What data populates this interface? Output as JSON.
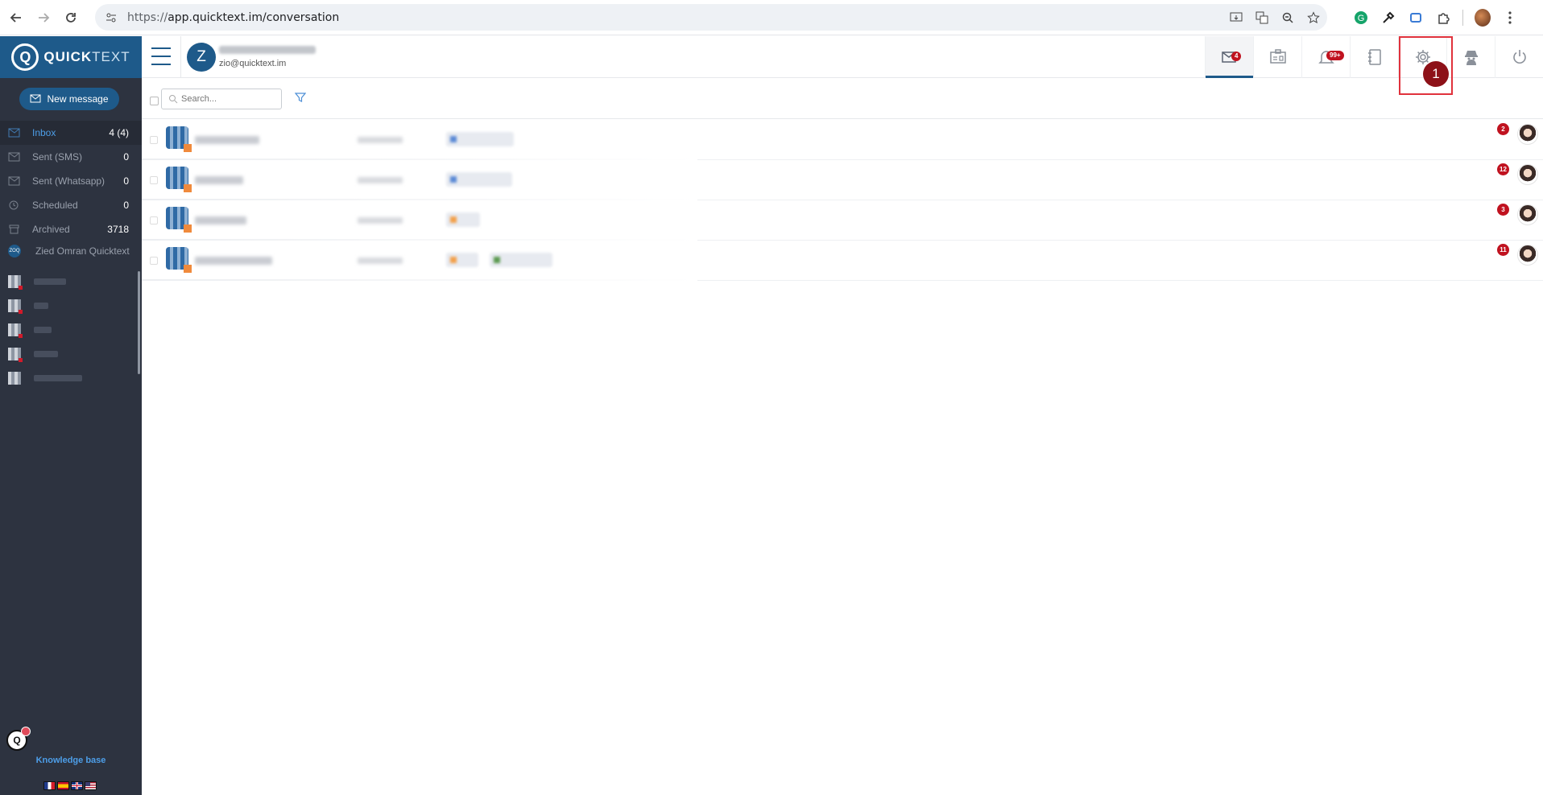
{
  "browser": {
    "url_scheme": "https://",
    "url_host": "app.quicktext.im/conversation"
  },
  "sidebar": {
    "logo_bold": "QUICK",
    "logo_light": "TEXT",
    "new_message_label": "New message",
    "folders": [
      {
        "label": "Inbox",
        "count": "4 (4)",
        "icon": "inbox-icon"
      },
      {
        "label": "Sent (SMS)",
        "count": "0",
        "icon": "sent-sms-icon"
      },
      {
        "label": "Sent (Whatsapp)",
        "count": "0",
        "icon": "sent-whatsapp-icon"
      },
      {
        "label": "Scheduled",
        "count": "0",
        "icon": "clock-icon"
      },
      {
        "label": "Archived",
        "count": "3718",
        "icon": "archive-icon"
      }
    ],
    "account_badge": "ZOQ",
    "account_name": "Zied Omran Quicktext",
    "knowledge_base_label": "Knowledge base",
    "kb_bubble_letter": "Q"
  },
  "topbar": {
    "user_initial": "Z",
    "user_email": "zio@quicktext.im",
    "icons": [
      {
        "name": "inbox-icon",
        "badge": "4"
      },
      {
        "name": "id-card-icon",
        "badge": ""
      },
      {
        "name": "bell-icon",
        "badge": "99+"
      },
      {
        "name": "notebook-icon",
        "badge": ""
      },
      {
        "name": "gear-icon",
        "badge": ""
      },
      {
        "name": "spy-icon",
        "badge": ""
      },
      {
        "name": "power-icon",
        "badge": ""
      }
    ],
    "step_marker": "1"
  },
  "filterbar": {
    "search_placeholder": "Search..."
  },
  "conversations": [
    {
      "unread": "2"
    },
    {
      "unread": "12"
    },
    {
      "unread": "3"
    },
    {
      "unread": "11"
    }
  ],
  "colors": {
    "brand": "#1e5a8a",
    "sidebar_bg": "#2d3340",
    "badge_red": "#c0121f",
    "highlight_red": "#e0323c"
  }
}
